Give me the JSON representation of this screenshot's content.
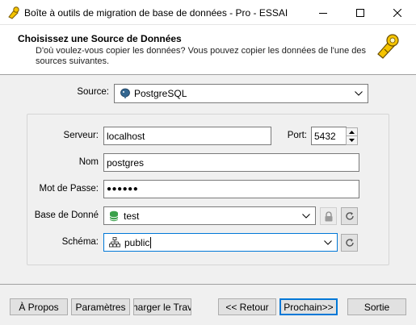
{
  "window": {
    "title": "Boîte à outils de migration de base de données - Pro - ESSAI"
  },
  "header": {
    "title": "Choisissez une Source de Données",
    "description": "D'où voulez-vous copier les données? Vous pouvez copier les données de l'une des sources suivantes."
  },
  "source": {
    "label": "Source:",
    "value": "PostgreSQL"
  },
  "connection": {
    "server_label": "Serveur:",
    "server_value": "localhost",
    "port_label": "Port:",
    "port_value": "5432",
    "name_label": "Nom",
    "name_value": "postgres",
    "password_label": "Mot de Passe:",
    "password_masked": "●●●●●●",
    "database_label": "Base de Donné",
    "database_value": "test",
    "schema_label": "Schéma:",
    "schema_value": "public"
  },
  "footer": {
    "about": "À Propos",
    "settings": "Paramètres",
    "load_job": "harger le Trava",
    "back": "<< Retour",
    "next": "Prochain>>",
    "exit": "Sortie"
  },
  "colors": {
    "accent": "#0078d7",
    "db_icon_green": "#3aa14a",
    "postgres_blue": "#336791"
  }
}
